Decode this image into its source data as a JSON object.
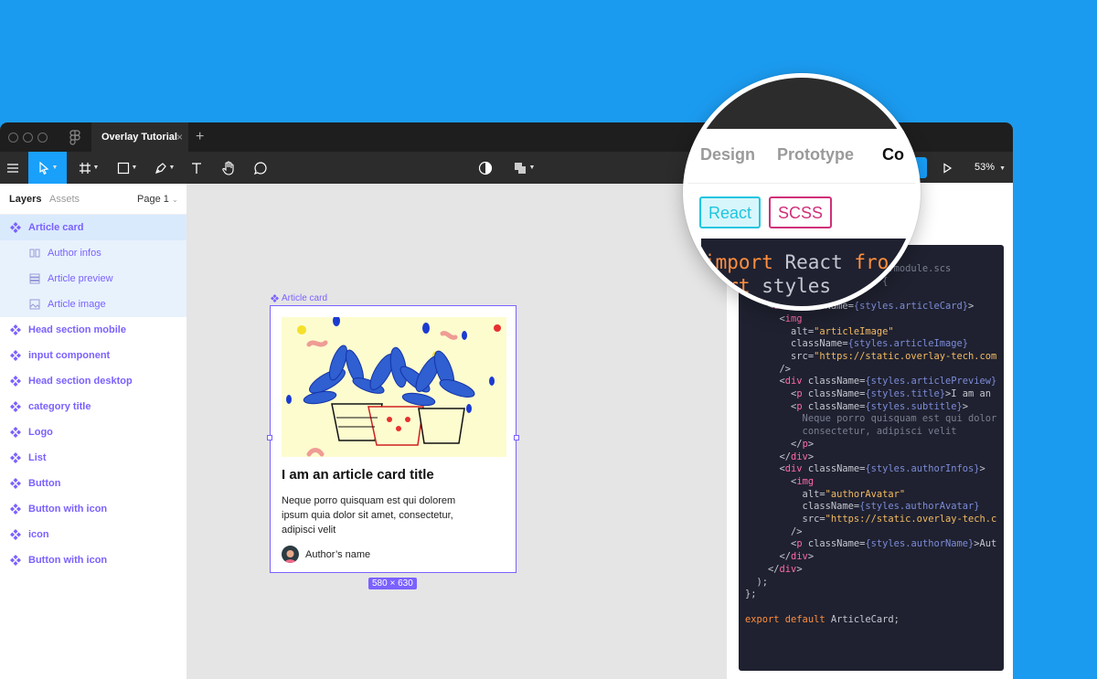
{
  "app": {
    "tab_title": "Overlay Tutorial",
    "tab_close": "×",
    "tab_add": "+",
    "zoom_level": "53%",
    "accent": "#18a0fb",
    "component_color": "#7b61ff"
  },
  "left_panel": {
    "tab_layers": "Layers",
    "tab_assets": "Assets",
    "page_selector": "Page 1",
    "layers": [
      {
        "label": "Article card",
        "icon": "component-icon"
      },
      {
        "label": "Author infos",
        "icon": "auto-layout-icon"
      },
      {
        "label": "Article preview",
        "icon": "frame-list-icon"
      },
      {
        "label": "Article image",
        "icon": "image-icon"
      },
      {
        "label": "Head section mobile",
        "icon": "component-icon"
      },
      {
        "label": "input component",
        "icon": "component-icon"
      },
      {
        "label": "Head section desktop",
        "icon": "component-icon"
      },
      {
        "label": "category title",
        "icon": "component-icon"
      },
      {
        "label": "Logo",
        "icon": "component-icon"
      },
      {
        "label": "List",
        "icon": "component-icon"
      },
      {
        "label": "Button",
        "icon": "component-icon"
      },
      {
        "label": "Button with icon",
        "icon": "component-icon"
      },
      {
        "label": "icon",
        "icon": "component-icon"
      },
      {
        "label": "Button with icon",
        "icon": "component-icon"
      }
    ]
  },
  "canvas": {
    "frame_label": "Article card",
    "card_title": "I am an article card title",
    "card_subtitle": "Neque porro quisquam est qui dolorem ipsum quia dolor sit amet, consectetur, adipisci velit",
    "author_name": "Author’s name",
    "size_badge": "580 × 630"
  },
  "magnifier": {
    "tab_design": "Design",
    "tab_prototype": "Prototype",
    "tab_code": "Co",
    "pill_react": "React",
    "pill_scss": "SCSS",
    "code_line1_kw": "import",
    "code_line1_id": " React ",
    "code_line1_kw2": "fro",
    "code_line2_kw": "port",
    "code_line2_id": " styles"
  }
}
